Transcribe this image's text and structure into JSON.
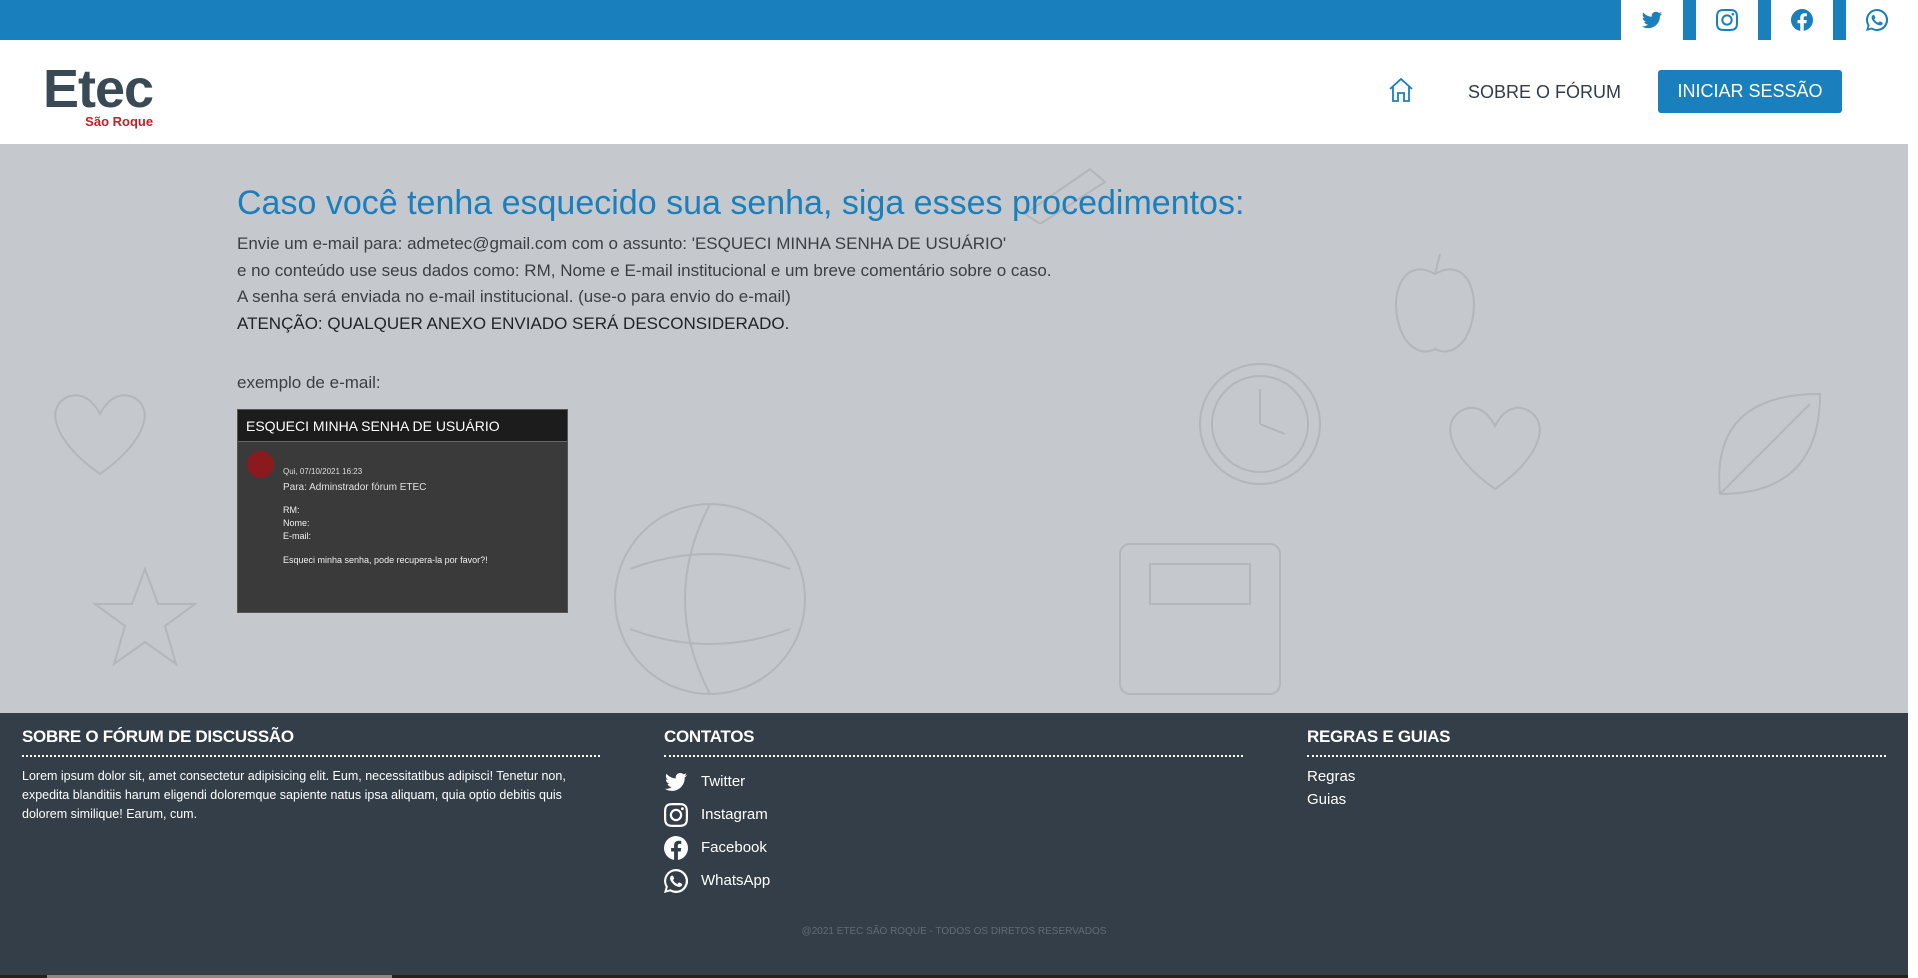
{
  "header": {
    "logo_main": "Etec",
    "logo_sub": "São Roque",
    "nav_about": "SOBRE O FÓRUM",
    "login_button": "INICIAR SESSÃO"
  },
  "social_top": [
    "twitter-icon",
    "instagram-icon",
    "facebook-icon",
    "whatsapp-icon"
  ],
  "main": {
    "heading": "Caso você tenha esquecido sua senha, siga esses procedimentos:",
    "line1": "Envie um e-mail para: admetec@gmail.com com o assunto: 'ESQUECI MINHA SENHA DE USUÁRIO'",
    "line2": "e no conteúdo use seus dados como: RM, Nome e E-mail institucional e um breve comentário sobre o caso.",
    "line3": "A senha será enviada no e-mail institucional. (use-o para envio do e-mail)",
    "warning": "ATENÇÃO: QUALQUER ANEXO ENVIADO SERÁ DESCONSIDERADO.",
    "example_label": "exemplo de e-mail:"
  },
  "email_example": {
    "subject": "ESQUECI MINHA SENHA DE USUÁRIO",
    "date": "Qui, 07/10/2021 16:23",
    "to": "Para: Adminstrador fórum ETEC",
    "field_rm": "RM:",
    "field_nome": "Nome:",
    "field_email": "E-mail:",
    "body": "Esqueci minha senha, pode recupera-la por favor?!"
  },
  "footer": {
    "about_title": "SOBRE O FÓRUM DE DISCUSSÃO",
    "about_text": "Lorem ipsum dolor sit, amet consectetur adipisicing elit. Eum, necessitatibus adipisci! Tenetur non, expedita blanditiis harum eligendi doloremque sapiente natus ipsa aliquam, quia optio debitis quis dolorem similique! Earum, cum.",
    "contacts_title": "CONTATOS",
    "contacts": [
      {
        "label": "Twitter",
        "icon": "twitter-icon"
      },
      {
        "label": "Instagram",
        "icon": "instagram-icon"
      },
      {
        "label": "Facebook",
        "icon": "facebook-icon"
      },
      {
        "label": "WhatsApp",
        "icon": "whatsapp-icon"
      }
    ],
    "rules_title": "REGRAS E GUIAS",
    "rules": [
      "Regras",
      "Guias"
    ],
    "copyright": "@2021 ETEC SÃO ROQUE - TODOS OS DIRETOS RESERVADOS"
  },
  "colors": {
    "brand_blue": "#1a7fbd",
    "footer_bg": "#333e48",
    "main_bg": "#c5c8cc",
    "logo_red": "#c0202a"
  }
}
